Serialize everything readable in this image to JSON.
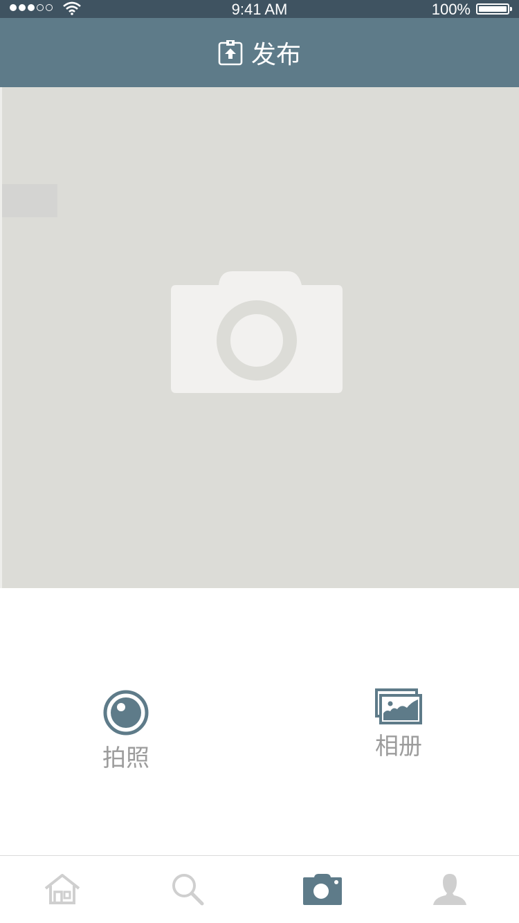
{
  "status_bar": {
    "time": "9:41 AM",
    "battery": "100%"
  },
  "nav": {
    "title": "发布",
    "icon": "upload-icon"
  },
  "preview": {
    "placeholder_icon": "camera-icon"
  },
  "actions": {
    "take_photo": {
      "label": "拍照",
      "icon": "eye-icon"
    },
    "album": {
      "label": "相册",
      "icon": "gallery-icon"
    }
  },
  "tab_bar": {
    "items": [
      {
        "icon": "home-icon",
        "active": false
      },
      {
        "icon": "search-icon",
        "active": false
      },
      {
        "icon": "camera-icon",
        "active": true
      },
      {
        "icon": "profile-icon",
        "active": false
      }
    ]
  },
  "colors": {
    "status_bar": "#3f5361",
    "nav_bar": "#5e7b89",
    "accent": "#5e7b89",
    "preview_bg": "#dcdcd7",
    "inactive_icon": "#cfcfcf",
    "label_text": "#9c9c9c"
  }
}
